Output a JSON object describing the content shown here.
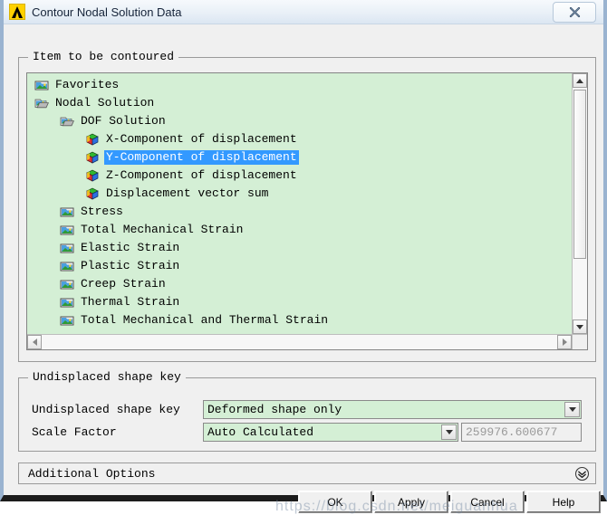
{
  "window": {
    "title": "Contour Nodal Solution Data",
    "app_icon": "ansys-logo-icon",
    "close_label": "Close"
  },
  "groups": {
    "item_to_be_contoured": "Item to be contoured",
    "undisplaced_shape_key": "Undisplaced shape key"
  },
  "tree": {
    "selected_index": 4,
    "items": [
      {
        "label": "Favorites",
        "indent": 0,
        "icon": "folder-closed-icon"
      },
      {
        "label": "Nodal Solution",
        "indent": 0,
        "icon": "folder-open-icon"
      },
      {
        "label": "DOF Solution",
        "indent": 1,
        "icon": "folder-open-icon"
      },
      {
        "label": "X-Component of displacement",
        "indent": 2,
        "icon": "cube-icon"
      },
      {
        "label": "Y-Component of displacement",
        "indent": 2,
        "icon": "cube-icon"
      },
      {
        "label": "Z-Component of displacement",
        "indent": 2,
        "icon": "cube-icon"
      },
      {
        "label": "Displacement vector sum",
        "indent": 2,
        "icon": "cube-icon"
      },
      {
        "label": "Stress",
        "indent": 1,
        "icon": "folder-closed-icon"
      },
      {
        "label": "Total Mechanical Strain",
        "indent": 1,
        "icon": "folder-closed-icon"
      },
      {
        "label": "Elastic Strain",
        "indent": 1,
        "icon": "folder-closed-icon"
      },
      {
        "label": "Plastic Strain",
        "indent": 1,
        "icon": "folder-closed-icon"
      },
      {
        "label": "Creep Strain",
        "indent": 1,
        "icon": "folder-closed-icon"
      },
      {
        "label": "Thermal Strain",
        "indent": 1,
        "icon": "folder-closed-icon"
      },
      {
        "label": "Total Mechanical and Thermal Strain",
        "indent": 1,
        "icon": "folder-closed-icon"
      }
    ]
  },
  "fields": {
    "undisplaced_shape_key": {
      "label": "Undisplaced shape key",
      "value": "Deformed shape only"
    },
    "scale_factor": {
      "label": "Scale Factor",
      "value": "Auto Calculated",
      "numeric_value": "259976.600677"
    }
  },
  "additional_options": {
    "label": "Additional Options",
    "expander_icon": "chevron-double-down-icon"
  },
  "buttons": {
    "ok": "OK",
    "apply": "Apply",
    "cancel": "Cancel",
    "help": "Help"
  },
  "watermark": "https://blog.csdn.net/meiguanhua",
  "colors": {
    "tree_background": "#d4efd5",
    "selection": "#3399ff",
    "dialog_background": "#f0f0f0",
    "window_border": "#9ab3d0"
  }
}
